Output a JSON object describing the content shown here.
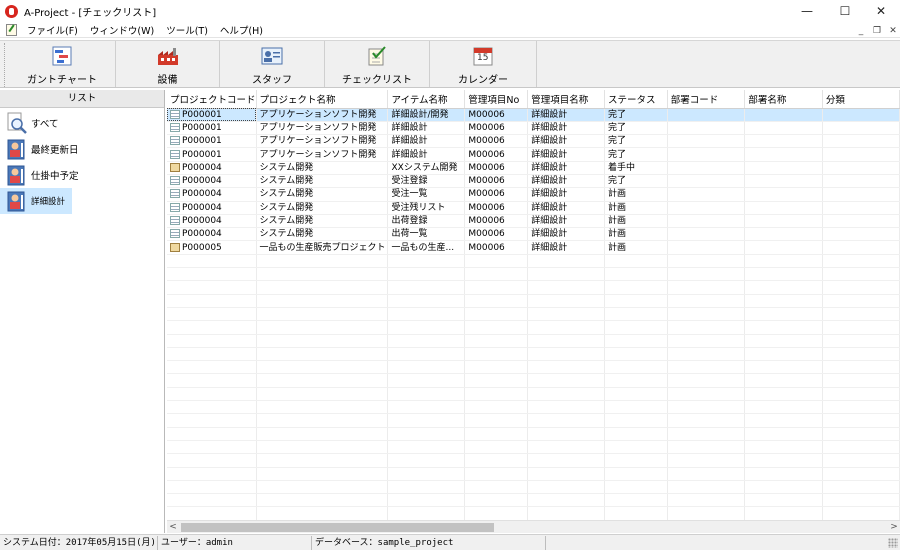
{
  "window": {
    "title": "A-Project - [チェックリスト]",
    "minimize": "—",
    "maximize": "☐",
    "close": "✕"
  },
  "menu": {
    "items": [
      "ファイル(F)",
      "ウィンドウ(W)",
      "ツール(T)",
      "ヘルプ(H)"
    ],
    "mdi_minimize": "_",
    "mdi_restore": "❐",
    "mdi_close": "✕"
  },
  "toolbar": {
    "buttons": [
      {
        "label": "ガントチャート",
        "icon": "gantt-chart-icon"
      },
      {
        "label": "設備",
        "icon": "factory-icon"
      },
      {
        "label": "スタッフ",
        "icon": "staff-card-icon"
      },
      {
        "label": "チェックリスト",
        "icon": "checklist-icon"
      },
      {
        "label": "カレンダー",
        "icon": "calendar-icon",
        "day": "15"
      }
    ]
  },
  "left_panel": {
    "header": "リスト",
    "items": [
      {
        "label": "すべて",
        "icon": "magnifier-icon"
      },
      {
        "label": "最終更新日",
        "icon": "user-list-icon"
      },
      {
        "label": "仕掛中予定",
        "icon": "user-list-icon"
      },
      {
        "label": "詳細設計",
        "icon": "user-list-icon",
        "selected": true
      }
    ]
  },
  "grid": {
    "columns": [
      "プロジェクトコード",
      "プロジェクト名称",
      "アイテム名称",
      "管理項目No",
      "管理項目名称",
      "ステータス",
      "部署コード",
      "部署名称",
      "分類"
    ],
    "rows": [
      {
        "icon": "doc",
        "cells": [
          "P000001",
          "アプリケーションソフト開発",
          "詳細設計/開発",
          "M00006",
          "詳細設計",
          "完了",
          "",
          "",
          ""
        ],
        "selected": true
      },
      {
        "icon": "doc",
        "cells": [
          "P000001",
          "アプリケーションソフト開発",
          "詳細設計",
          "M00006",
          "詳細設計",
          "完了",
          "",
          "",
          ""
        ]
      },
      {
        "icon": "doc",
        "cells": [
          "P000001",
          "アプリケーションソフト開発",
          "詳細設計",
          "M00006",
          "詳細設計",
          "完了",
          "",
          "",
          ""
        ]
      },
      {
        "icon": "doc",
        "cells": [
          "P000001",
          "アプリケーションソフト開発",
          "詳細設計",
          "M00006",
          "詳細設計",
          "完了",
          "",
          "",
          ""
        ]
      },
      {
        "icon": "project",
        "cells": [
          "P000004",
          "システム開発",
          "XXシステム開発",
          "M00006",
          "詳細設計",
          "着手中",
          "",
          "",
          ""
        ]
      },
      {
        "icon": "doc",
        "cells": [
          "P000004",
          "システム開発",
          "受注登録",
          "M00006",
          "詳細設計",
          "完了",
          "",
          "",
          ""
        ]
      },
      {
        "icon": "doc",
        "cells": [
          "P000004",
          "システム開発",
          "受注一覧",
          "M00006",
          "詳細設計",
          "計画",
          "",
          "",
          ""
        ]
      },
      {
        "icon": "doc",
        "cells": [
          "P000004",
          "システム開発",
          "受注残リスト",
          "M00006",
          "詳細設計",
          "計画",
          "",
          "",
          ""
        ]
      },
      {
        "icon": "doc",
        "cells": [
          "P000004",
          "システム開発",
          "出荷登録",
          "M00006",
          "詳細設計",
          "計画",
          "",
          "",
          ""
        ]
      },
      {
        "icon": "doc",
        "cells": [
          "P000004",
          "システム開発",
          "出荷一覧",
          "M00006",
          "詳細設計",
          "計画",
          "",
          "",
          ""
        ]
      },
      {
        "icon": "project",
        "cells": [
          "P000005",
          "一品もの生産販売プロジェクト",
          "一品もの生産...",
          "M00006",
          "詳細設計",
          "計画",
          "",
          "",
          ""
        ]
      }
    ]
  },
  "scroll": {
    "left": "<",
    "right": ">"
  },
  "status": {
    "system_date": "システム日付：2017年05月15日(月)",
    "user": "ユーザー：admin",
    "database": "データベース：sample_project"
  }
}
